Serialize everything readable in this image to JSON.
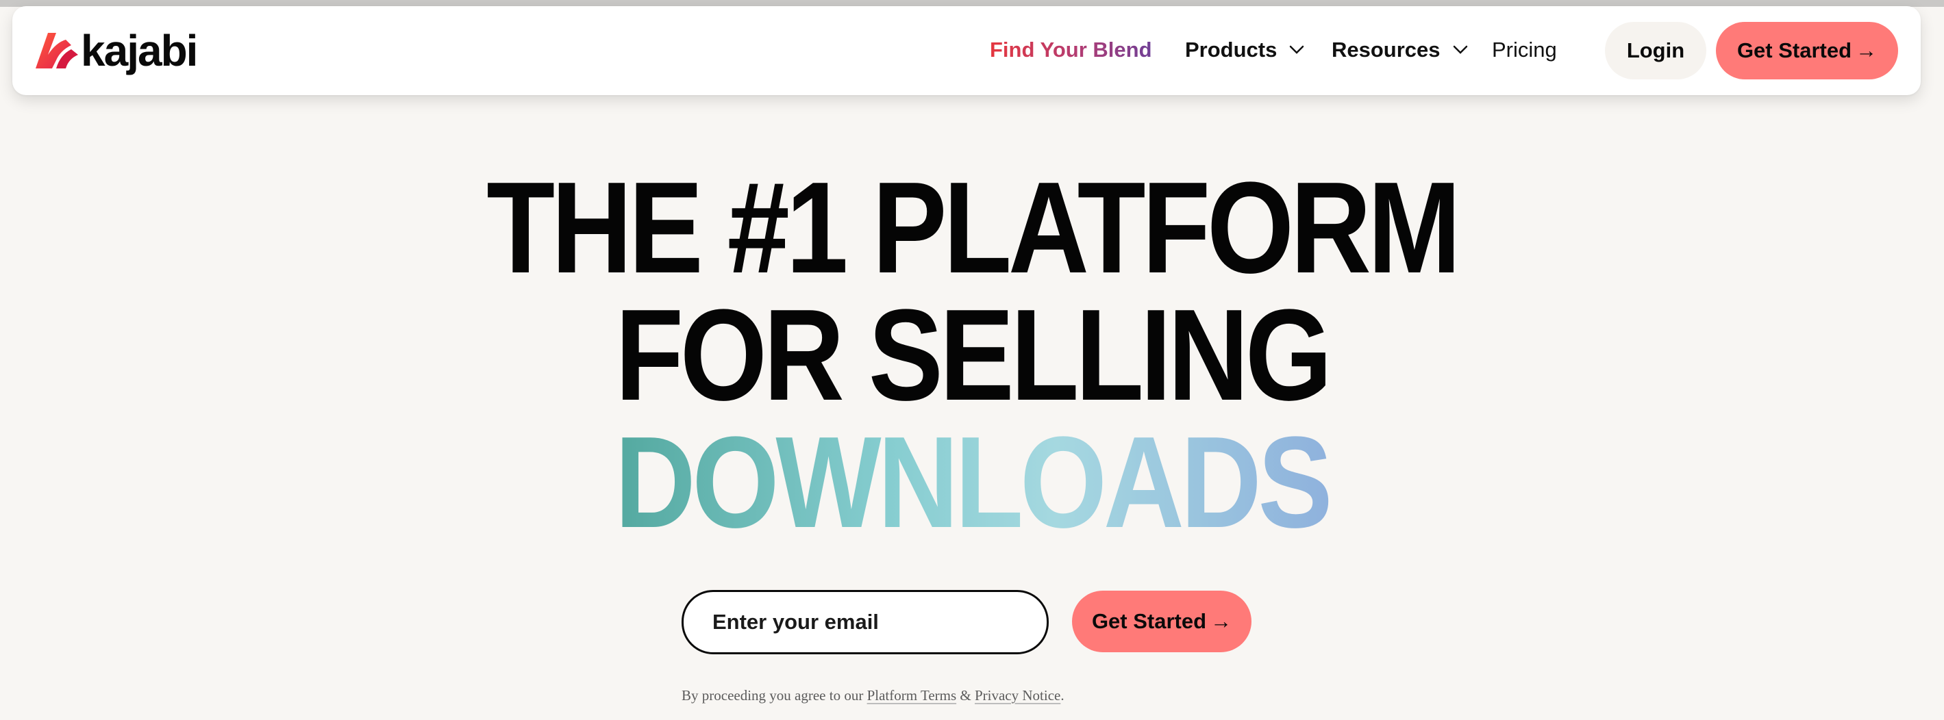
{
  "brand": {
    "name": "kajabi",
    "logo_icon": "kajabi-k-logo",
    "accent_color": "#ff7a78"
  },
  "nav": {
    "find_your_blend": "Find Your Blend",
    "products": "Products",
    "resources": "Resources",
    "pricing": "Pricing",
    "login": "Login",
    "get_started": "Get Started",
    "arrow": "→"
  },
  "hero": {
    "line1": "THE #1 PLATFORM",
    "line2": "FOR SELLING",
    "line3": "DOWNLOADS"
  },
  "signup": {
    "email_placeholder": "Enter your email",
    "email_value": "",
    "cta": "Get Started",
    "arrow": "→"
  },
  "legal": {
    "prefix": "By proceeding you agree to our ",
    "terms": "Platform Terms",
    "amp": " & ",
    "privacy": "Privacy Notice",
    "suffix": "."
  }
}
